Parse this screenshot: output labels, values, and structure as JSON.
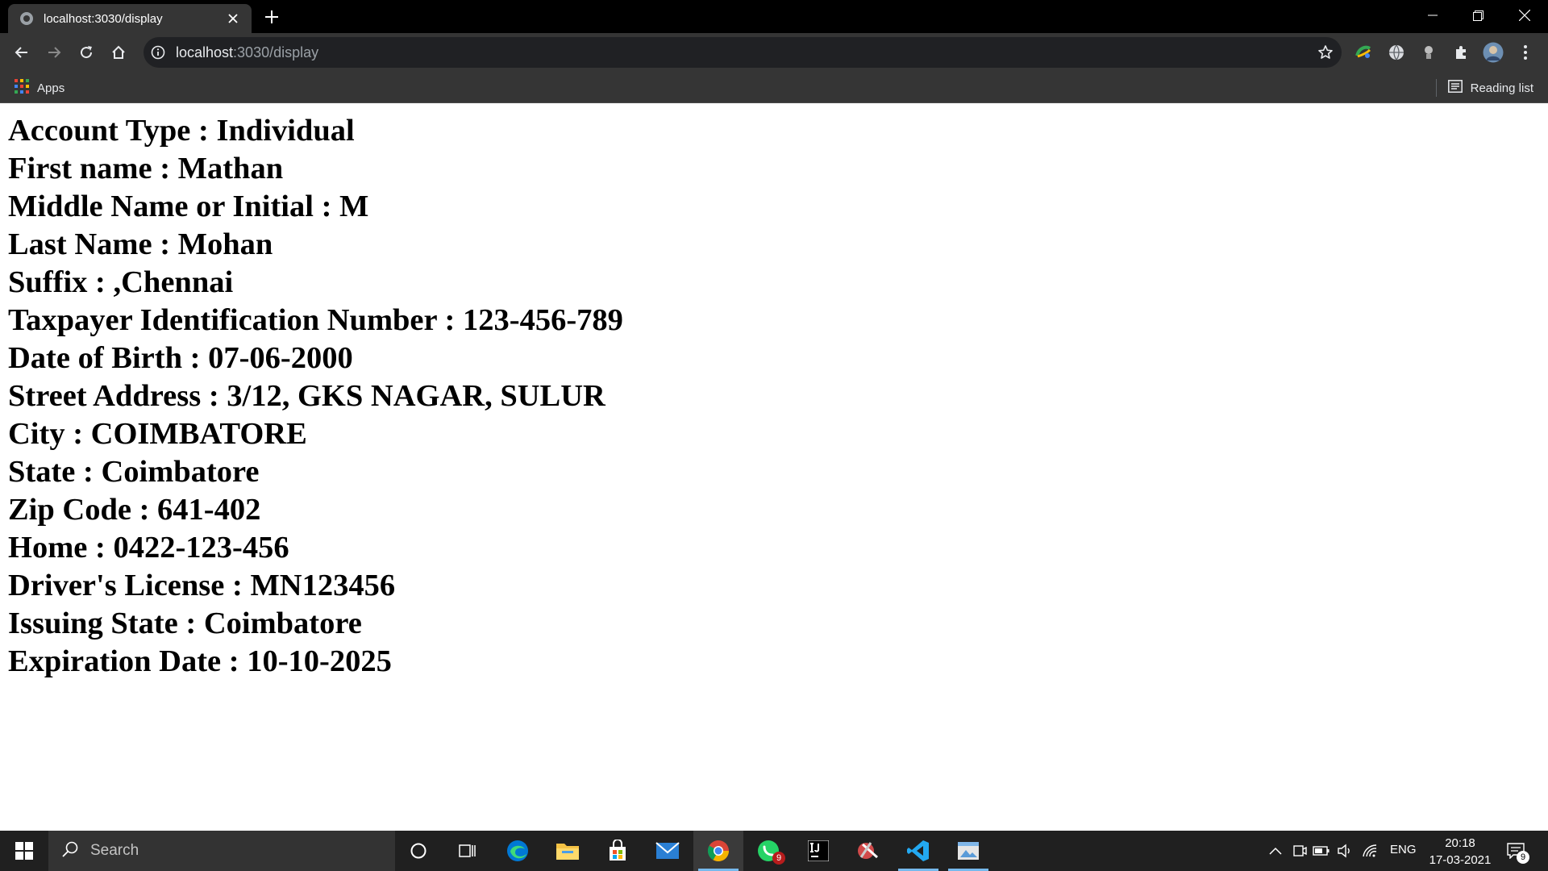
{
  "browser": {
    "tab_title": "localhost:3030/display",
    "url_host": "localhost",
    "url_path": ":3030/display",
    "bookmarks": {
      "apps_label": "Apps",
      "reading_list_label": "Reading list"
    }
  },
  "page": {
    "fields": [
      {
        "label": "Account Type",
        "value": "Individual"
      },
      {
        "label": "First name",
        "value": "Mathan"
      },
      {
        "label": "Middle Name or Initial",
        "value": "M"
      },
      {
        "label": "Last Name",
        "value": "Mohan"
      },
      {
        "label": "Suffix",
        "value": ",Chennai"
      },
      {
        "label": "Taxpayer Identification Number",
        "value": "123-456-789"
      },
      {
        "label": "Date of Birth",
        "value": "07-06-2000"
      },
      {
        "label": "Street Address",
        "value": "3/12, GKS NAGAR, SULUR"
      },
      {
        "label": "City",
        "value": "COIMBATORE"
      },
      {
        "label": "State",
        "value": "Coimbatore"
      },
      {
        "label": "Zip Code",
        "value": "641-402"
      },
      {
        "label": "Home",
        "value": "0422-123-456"
      },
      {
        "label": "Driver's License",
        "value": "MN123456"
      },
      {
        "label": "Issuing State",
        "value": "Coimbatore"
      },
      {
        "label": "Expiration Date",
        "value": "10-10-2025"
      }
    ]
  },
  "taskbar": {
    "search_placeholder": "Search",
    "whatsapp_badge": "9",
    "language": "ENG",
    "time": "20:18",
    "date": "17-03-2021",
    "notification_count": "9"
  },
  "colors": {
    "chrome_dark": "#353535",
    "tabstrip": "#000000",
    "taskbar": "#202020",
    "edge_blue": "#0078d4",
    "vscode_blue": "#23a9f2",
    "chrome_red": "#db4437",
    "chrome_green": "#0f9d58",
    "chrome_yellow": "#f4b400"
  }
}
